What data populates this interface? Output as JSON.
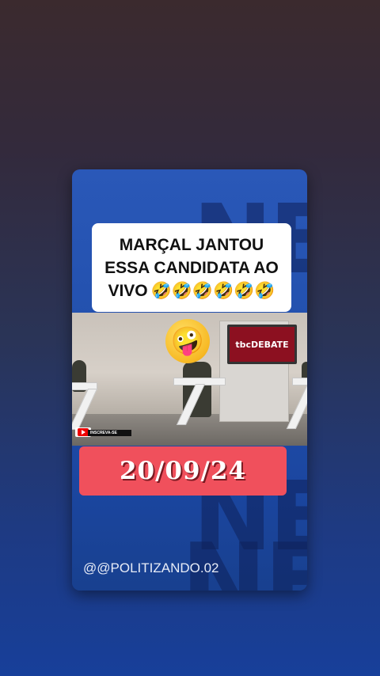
{
  "caption": {
    "line1": "MARÇAL JANTOU",
    "line2": "ESSA CANDIDATA AO",
    "line3": "VIVO",
    "emojis": "🤣🤣🤣🤣🤣🤣"
  },
  "video": {
    "broadcast_logo": "tbcDEBATE",
    "face_emoji": "🤪",
    "subscribe_label": "INSCREVA-SE"
  },
  "date_banner": "20/09/24",
  "handle": "@@POLITIZANDO.02",
  "background_text": "NEWS",
  "colors": {
    "card_blue": "#2250ad",
    "date_red": "#f0505c",
    "screen_red": "#8c1020"
  }
}
